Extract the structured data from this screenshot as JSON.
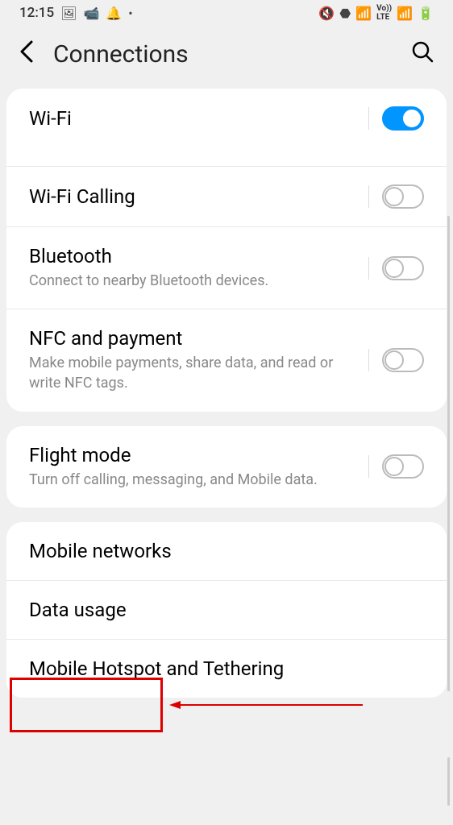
{
  "statusBar": {
    "time": "12:15",
    "leftIcons": [
      "🖼",
      "📹",
      "🔔",
      "•"
    ],
    "rightIcons": [
      "🔇",
      "⬣",
      "📶",
      "LTE",
      "📶",
      "🔋"
    ]
  },
  "header": {
    "title": "Connections"
  },
  "sections": [
    {
      "rows": [
        {
          "title": "Wi-Fi",
          "toggle": true,
          "on": true,
          "wifi": true
        },
        {
          "title": "Wi-Fi Calling",
          "toggle": true,
          "on": false
        },
        {
          "title": "Bluetooth",
          "subtitle": "Connect to nearby Bluetooth devices.",
          "toggle": true,
          "on": false
        },
        {
          "title": "NFC and payment",
          "subtitle": "Make mobile payments, share data, and read or write NFC tags.",
          "toggle": true,
          "on": false
        }
      ]
    },
    {
      "rows": [
        {
          "title": "Flight mode",
          "subtitle": "Turn off calling, messaging, and Mobile data.",
          "toggle": true,
          "on": false
        }
      ]
    },
    {
      "rows": [
        {
          "title": "Mobile networks"
        },
        {
          "title": "Data usage"
        },
        {
          "title": "Mobile Hotspot and Tethering"
        }
      ]
    }
  ]
}
